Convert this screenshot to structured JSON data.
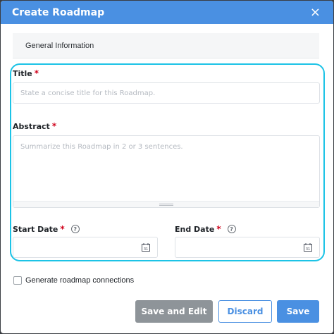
{
  "dialog": {
    "title": "Create Roadmap",
    "close_glyph": "×"
  },
  "section": {
    "label": "General Information"
  },
  "form": {
    "title": {
      "label": "Title",
      "required": "*",
      "placeholder": "State a concise title for this Roadmap."
    },
    "abstract": {
      "label": "Abstract",
      "required": "*",
      "placeholder": "Summarize this Roadmap in 2 or 3 sentences."
    },
    "start_date": {
      "label": "Start Date",
      "required": "*",
      "help": "?",
      "value": ""
    },
    "end_date": {
      "label": "End Date",
      "required": "*",
      "help": "?",
      "value": ""
    }
  },
  "options": {
    "connections_label": "Generate roadmap connections",
    "connections_checked": false
  },
  "buttons": {
    "save_and_edit": "Save and Edit",
    "discard": "Discard",
    "save": "Save"
  },
  "colors": {
    "accent": "#4a90e2",
    "focus_ring": "#1cc3e6",
    "required": "#d0021b",
    "disabled_button": "#8e9499"
  },
  "icons": {
    "close": "close-icon",
    "help": "help-circle-icon",
    "calendar": "calendar-icon",
    "resize": "resize-handle-icon"
  }
}
